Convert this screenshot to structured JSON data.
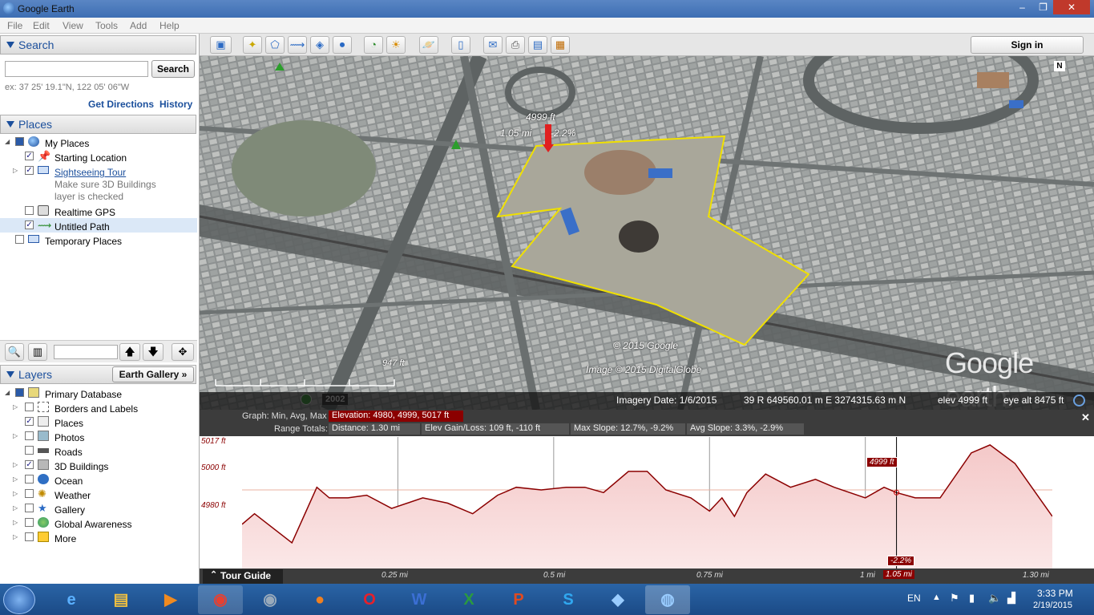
{
  "window": {
    "title": "Google Earth",
    "min": "‒",
    "max": "❐",
    "close": "✕"
  },
  "menu": [
    "File",
    "Edit",
    "View",
    "Tools",
    "Add",
    "Help"
  ],
  "search": {
    "header": "Search",
    "placeholder": "",
    "button": "Search",
    "hint": "ex: 37 25' 19.1\"N, 122 05' 06\"W",
    "directions": "Get Directions",
    "history": "History"
  },
  "places": {
    "header": "Places",
    "items": [
      {
        "label": "My Places",
        "checked": true,
        "icon": "globe-icon"
      },
      {
        "label": "Starting Location",
        "checked": true,
        "icon": "pushpin-icon"
      },
      {
        "label": "Sightseeing Tour",
        "checked": true,
        "icon": "folder-icon",
        "link": true
      },
      {
        "label": "Make sure 3D Buildings",
        "note": true
      },
      {
        "label": "layer is checked",
        "note": true
      },
      {
        "label": "Realtime GPS",
        "checked": false,
        "icon": "gps-icon"
      },
      {
        "label": "Untitled Path",
        "checked": true,
        "icon": "path-icon"
      },
      {
        "label": "Temporary Places",
        "checked": false,
        "icon": "folder-icon"
      }
    ]
  },
  "layers": {
    "header": "Layers",
    "gallery_button": "Earth Gallery »",
    "items": [
      {
        "label": "Primary Database",
        "checked": true
      },
      {
        "label": "Borders and Labels",
        "checked": false
      },
      {
        "label": "Places",
        "checked": true
      },
      {
        "label": "Photos",
        "checked": false
      },
      {
        "label": "Roads",
        "checked": false
      },
      {
        "label": "3D Buildings",
        "checked": true
      },
      {
        "label": "Ocean",
        "checked": false
      },
      {
        "label": "Weather",
        "checked": false
      },
      {
        "label": "Gallery",
        "checked": false
      },
      {
        "label": "Global Awareness",
        "checked": false
      },
      {
        "label": "More",
        "checked": false
      }
    ]
  },
  "toolbar": {
    "sign_in": "Sign in"
  },
  "map": {
    "marker_elev": "4999 ft",
    "marker_dist": "1.05 mi",
    "marker_slope": "-2.2%",
    "copyright": "© 2015 Google",
    "imagery": "Image © 2015 DigitalGlobe",
    "brand": "Google earth",
    "scale": "947 ft",
    "year": "2002",
    "north": "N"
  },
  "status": {
    "date": "Imagery Date: 1/6/2015",
    "coords": "39 R 649560.01 m E 3274315.63 m N",
    "elev": "elev  4999 ft",
    "eye": "eye alt  8475 ft"
  },
  "profile": {
    "graph_label": "Graph: Min, Avg, Max",
    "elevation": "Elevation: 4980, 4999, 5017 ft",
    "range_label": "Range Totals:",
    "distance": "Distance: 1.30 mi",
    "gainloss": "Elev Gain/Loss: 109 ft, -110 ft",
    "max_slope": "Max Slope: 12.7%, -9.2%",
    "avg_slope": "Avg Slope: 3.3%, -2.9%",
    "y_ticks": [
      "5017 ft",
      "5000 ft",
      "4980 ft"
    ],
    "x_ticks": [
      "0.25 mi",
      "0.5 mi",
      "0.75 mi",
      "1 mi",
      "1.30 mi"
    ],
    "cursor_x": "1.05 mi",
    "cursor_elev": "4999 ft",
    "cursor_slope": "-2.2%",
    "close": "✕",
    "tour_guide": "Tour Guide"
  },
  "chart_data": {
    "type": "area",
    "xlabel": "",
    "ylabel": "",
    "xlim": [
      0,
      1.3
    ],
    "ylim": [
      4970,
      5020
    ],
    "x": [
      0,
      0.02,
      0.08,
      0.12,
      0.14,
      0.17,
      0.2,
      0.24,
      0.29,
      0.33,
      0.37,
      0.41,
      0.44,
      0.48,
      0.52,
      0.55,
      0.58,
      0.62,
      0.65,
      0.68,
      0.72,
      0.75,
      0.77,
      0.79,
      0.81,
      0.84,
      0.88,
      0.92,
      0.95,
      1.0,
      1.03,
      1.05,
      1.08,
      1.12,
      1.17,
      1.2,
      1.24,
      1.3
    ],
    "y": [
      4987,
      4991,
      4980,
      5001,
      4997,
      4997,
      4998,
      4993,
      4997,
      4995,
      4991,
      4998,
      5001,
      5000,
      5001,
      5001,
      4999,
      5007,
      5007,
      5000,
      4997,
      4992,
      4997,
      4990,
      4999,
      5006,
      5001,
      5004,
      5001,
      4997,
      5001,
      4999,
      4997,
      4997,
      5014,
      5017,
      5010,
      4990
    ]
  },
  "taskbar": {
    "lang": "EN",
    "time": "3:33 PM",
    "date": "2/19/2015"
  }
}
